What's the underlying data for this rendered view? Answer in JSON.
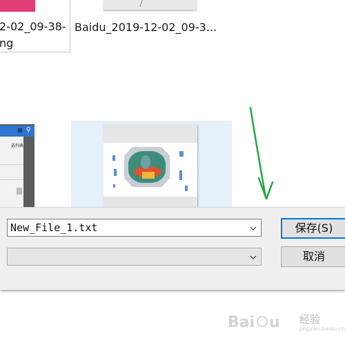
{
  "file_area": {
    "files": [
      {
        "name_line1": "2-02_09-38-",
        "name_line2": "ng",
        "thumb_color": "#e23d79",
        "selected": false
      },
      {
        "name_line1": "Baidu_2019-12-02_09-3...",
        "selected": false
      },
      {
        "name_partial_text": "选列表",
        "selected": false
      },
      {
        "selected": true
      }
    ]
  },
  "save_bar": {
    "filename_value": "New_File_1.txt",
    "filetype_value": "",
    "save_label": "保存(S)",
    "cancel_label": "取消"
  },
  "annotation": {
    "arrow_color": "#22a844",
    "arrow_icon": "green-arrow-icon"
  },
  "watermark": {
    "brand": "Baidu",
    "suffix": "经验",
    "url": "jingyan.baidu.com"
  },
  "colors": {
    "accent": "#0078d7",
    "selection_bg": "#e5f1fb",
    "bar_bg": "#f0f0f0"
  }
}
